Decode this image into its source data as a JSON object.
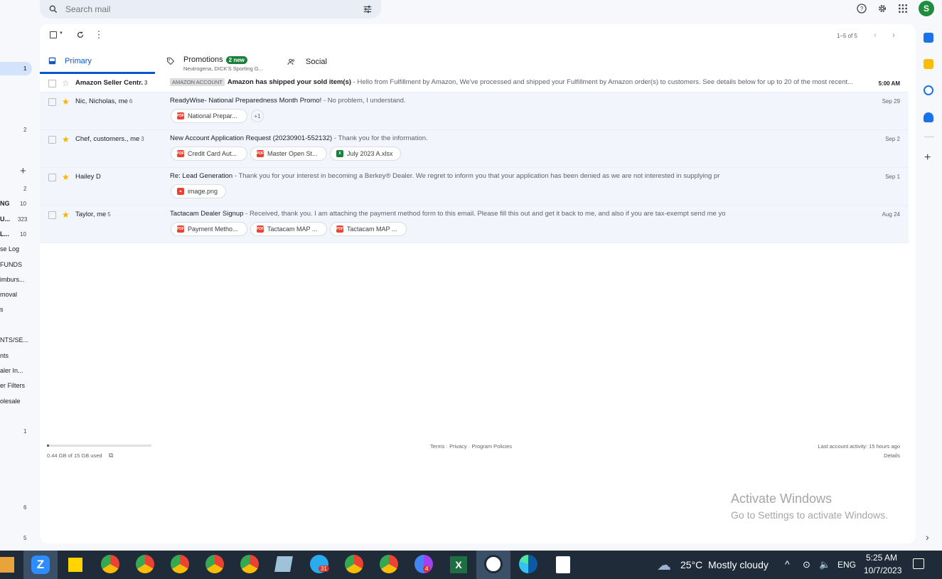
{
  "search": {
    "placeholder": "Search mail"
  },
  "account": {
    "avatar_letter": "S"
  },
  "toolbar": {
    "range": "1–5 of 5"
  },
  "tabs": [
    {
      "label": "Primary"
    },
    {
      "label": "Promotions",
      "badge": "2 new",
      "sub": "Neutrogena, DICK'S Sporting G..."
    },
    {
      "label": "Social"
    }
  ],
  "emails": [
    {
      "sender": "Amazon Seller Centr.",
      "count": "3",
      "tag": "AMAZON ACCOUNT",
      "subject": "Amazon has shipped your sold item(s)",
      "snippet": " - Hello from Fulfillment by Amazon, We've processed and shipped your Fulfillment by Amazon order(s) to customers. See details below for up to 20 of the most recent...",
      "date": "5:00 AM"
    },
    {
      "sender": "Nic, Nicholas, me",
      "count": "6",
      "subject": "ReadyWise- National Preparedness Month Promo!",
      "snippet": " - No problem, I understand.",
      "date": "Sep 29",
      "attachments": [
        "National Prepar...",
        "+1"
      ]
    },
    {
      "sender": "Chef, customers., me",
      "count": "3",
      "subject": "New Account Application Request (20230901-552132)",
      "snippet": " - Thank you for the information.",
      "date": "Sep 2",
      "attachments": [
        "Credit Card Aut...",
        "Master Open St...",
        "July 2023 A.xlsx"
      ]
    },
    {
      "sender": "Hailey D",
      "count": "",
      "subject": "Re: Lead Generation",
      "snippet": " - Thank you for your interest in becoming a Berkey® Dealer. We regret to inform you that your application has been denied as we are not interested in supplying pr",
      "date": "Sep 1",
      "attachments": [
        "image.png"
      ]
    },
    {
      "sender": "Taylor, me",
      "count": "5",
      "subject": "Tactacam Dealer Signup",
      "snippet": " - Received, thank you. I am attaching the payment method form to this email. Please fill this out and get it back to me, and also if you are tax-exempt send me yo",
      "date": "Aug 24",
      "attachments": [
        "Payment Metho...",
        "Tactacam MAP ...",
        "Tactacam MAP ..."
      ]
    }
  ],
  "footer": {
    "storage": "0.44 GB of 15 GB used",
    "links": "Terms · Privacy · Program Policies",
    "activity": "Last account activity: 15 hours ago",
    "details": "Details"
  },
  "sidebar": {
    "counts": [
      "1",
      "2",
      "2",
      "10",
      "323",
      "10",
      "1",
      "6",
      "5"
    ],
    "labels": [
      "NG",
      "U...",
      "L...",
      "se Log",
      "FUNDS",
      "imburs...",
      "moval",
      "s",
      "NTS/SE...",
      "nts",
      "aler In...",
      "er Filters",
      "olesale"
    ],
    "plus": "+"
  },
  "watermark": {
    "line1": "Activate Windows",
    "line2": "Go to Settings to activate Windows."
  },
  "taskbar": {
    "weather": "25°C  Mostly cloudy",
    "lang": "ENG",
    "time": "5:25 AM",
    "date": "10/7/2023",
    "telegram_badge": "31",
    "chrome_badge": "4"
  },
  "colors": {
    "accent": "#0b57d0",
    "star": "#f4b400",
    "green": "#188038",
    "pdf": "#ea4335"
  }
}
